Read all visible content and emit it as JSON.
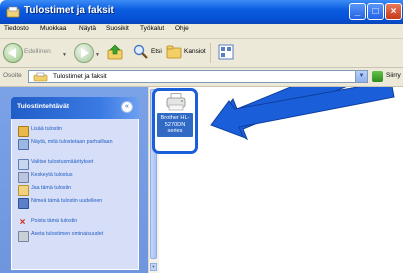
{
  "window": {
    "title": "Tulostimet ja faksit"
  },
  "menu": {
    "items": [
      "Tiedosto",
      "Muokkaa",
      "Näytä",
      "Suosikit",
      "Työkalut",
      "Ohje"
    ]
  },
  "toolbar": {
    "back_label": "Edellinen",
    "search_label": "Etsi",
    "folders_label": "Kansiot"
  },
  "address": {
    "label": "Osoite",
    "value": "Tulostimet ja faksit",
    "go_label": "Siirry"
  },
  "tasks": {
    "title": "Tulostintehtävät",
    "items": [
      {
        "label": "Lisää tulostin",
        "icon": "add-printer-icon"
      },
      {
        "label": "Näytä, mitä tulostetaan parhaillaan",
        "icon": "queue-icon"
      },
      {
        "label": "Valitse tulostusmääritykset",
        "icon": "preferences-icon"
      },
      {
        "label": "Keskeytä tulostus",
        "icon": "pause-icon"
      },
      {
        "label": "Jaa tämä tulostin",
        "icon": "share-icon"
      },
      {
        "label": "Nimeä tämä tulostin uudelleen",
        "icon": "rename-icon"
      },
      {
        "label": "Poista tämä tulostin",
        "icon": "delete-icon"
      },
      {
        "label": "Aseta tulostimen ominaisuudet",
        "icon": "properties-icon"
      }
    ]
  },
  "printer": {
    "label": "Brother HL-5270DN series"
  },
  "colors": {
    "titlebar": "#0a5de0",
    "accent": "#1b5ed9",
    "task_text": "#215dc6",
    "left_pane": "#7ba2e7"
  }
}
